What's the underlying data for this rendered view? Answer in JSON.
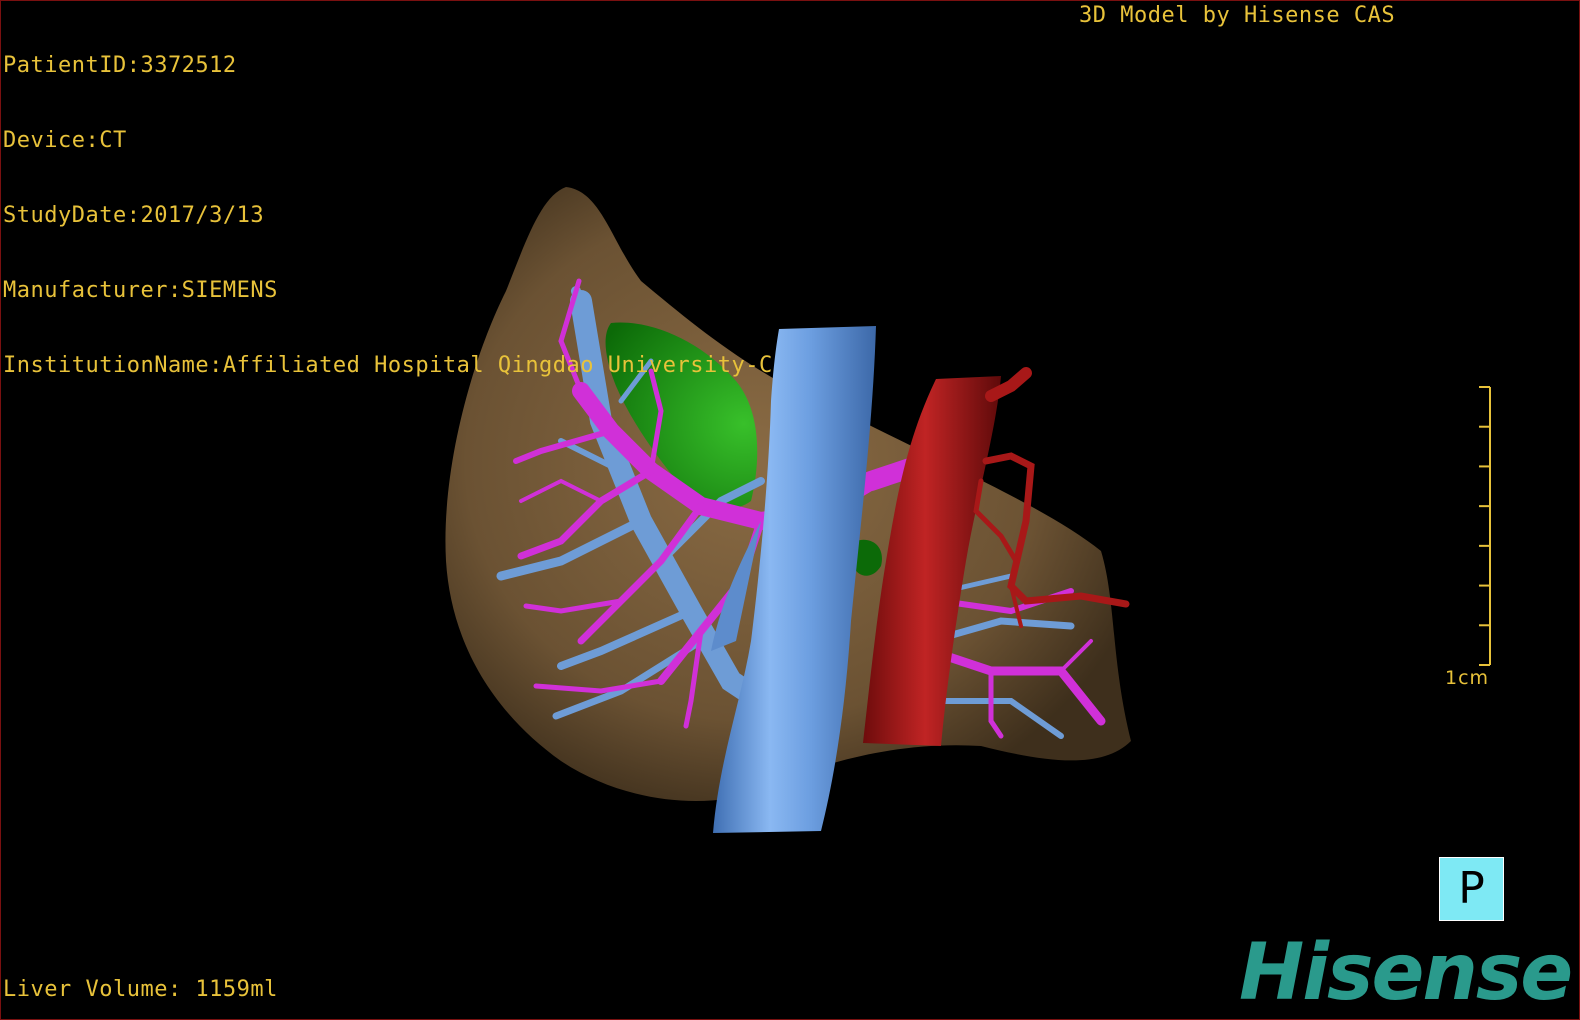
{
  "info": {
    "patient_id": "PatientID:3372512",
    "device": "Device:CT",
    "study_date": "StudyDate:2017/3/13",
    "manufacturer": "Manufacturer:SIEMENS",
    "institution": "InstitutionName:Affiliated Hospital Qingdao University-C"
  },
  "credit": "3D Model by Hisense CAS",
  "liver_volume": "Liver Volume: 1159ml",
  "scale": {
    "label": "1cm",
    "tick_count": 8
  },
  "orientation": {
    "label": "P"
  },
  "logo": {
    "text": "Hisense"
  },
  "model": {
    "structures": [
      {
        "name": "liver-parenchyma",
        "color": "#6e5535"
      },
      {
        "name": "portal-vein-branches",
        "color": "#d030d8"
      },
      {
        "name": "hepatic-vein-branches",
        "color": "#6e9cd6"
      },
      {
        "name": "inferior-vena-cava",
        "color": "#6fa2e6"
      },
      {
        "name": "aorta",
        "color": "#a81818"
      },
      {
        "name": "gallbladder",
        "color": "#1a9a10"
      }
    ]
  },
  "colors": {
    "text": "#e8c23a",
    "orient_box": "#7ee9f4",
    "logo": "#2a9a8c",
    "border": "#7a1010"
  }
}
